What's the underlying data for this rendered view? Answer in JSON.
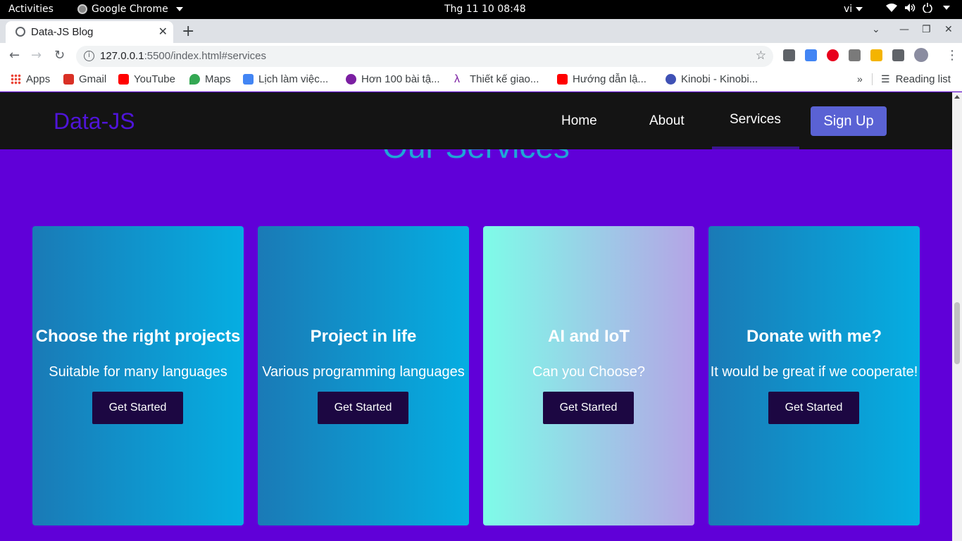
{
  "system_bar": {
    "activities": "Activities",
    "app_name": "Google Chrome",
    "clock": "Thg 11 10  08:48",
    "language": "vi"
  },
  "browser": {
    "tab_title": "Data-JS Blog",
    "url_host": "127.0.0.1",
    "url_rest": ":5500/index.html#services",
    "bookmarks": [
      {
        "label": "Apps",
        "icon": "apps-grid-icon",
        "color": "#ea4335"
      },
      {
        "label": "Gmail",
        "icon": "gmail-icon",
        "color": "#d93025"
      },
      {
        "label": "YouTube",
        "icon": "youtube-icon",
        "color": "#ff0000"
      },
      {
        "label": "Maps",
        "icon": "maps-icon",
        "color": "#34a853"
      },
      {
        "label": "Lịch làm việc...",
        "icon": "calendar-icon",
        "color": "#4285f4"
      },
      {
        "label": "Hơn 100 bài tậ...",
        "icon": "at-icon",
        "color": "#7b1fa2"
      },
      {
        "label": "Thiết kế giao...",
        "icon": "lambda-icon",
        "color": "#7b1fa2"
      },
      {
        "label": "Hướng dẫn lậ...",
        "icon": "youtube-icon",
        "color": "#ff0000"
      },
      {
        "label": "Kinobi - Kinobi...",
        "icon": "kinobi-icon",
        "color": "#3f51b5"
      }
    ],
    "more": "»",
    "reading_list": "Reading list"
  },
  "site": {
    "logo": "Data-JS",
    "nav": {
      "home": "Home",
      "about": "About",
      "services": "Services",
      "signup": "Sign Up"
    },
    "section_title": "Our Services",
    "cards": [
      {
        "title": "Choose the right projects",
        "subtitle": "Suitable for many languages",
        "button": "Get Started"
      },
      {
        "title": "Project in life",
        "subtitle": "Various programming languages",
        "button": "Get Started"
      },
      {
        "title": "AI and IoT",
        "subtitle": "Can you Choose?",
        "button": "Get Started"
      },
      {
        "title": "Donate with me?",
        "subtitle": "It would be great if we cooperate!",
        "button": "Get Started"
      }
    ]
  },
  "colors": {
    "page_bg": "#6000d8",
    "navbar_bg": "#141414",
    "logo": "#4f14d9",
    "signup_bg": "#5a62d4",
    "card_blue_start": "#1a7ab6",
    "card_blue_end": "#05aee2",
    "card_aqua_start": "#7efce8",
    "card_aqua_end": "#b5a4e6",
    "button_bg": "#1c0742"
  }
}
